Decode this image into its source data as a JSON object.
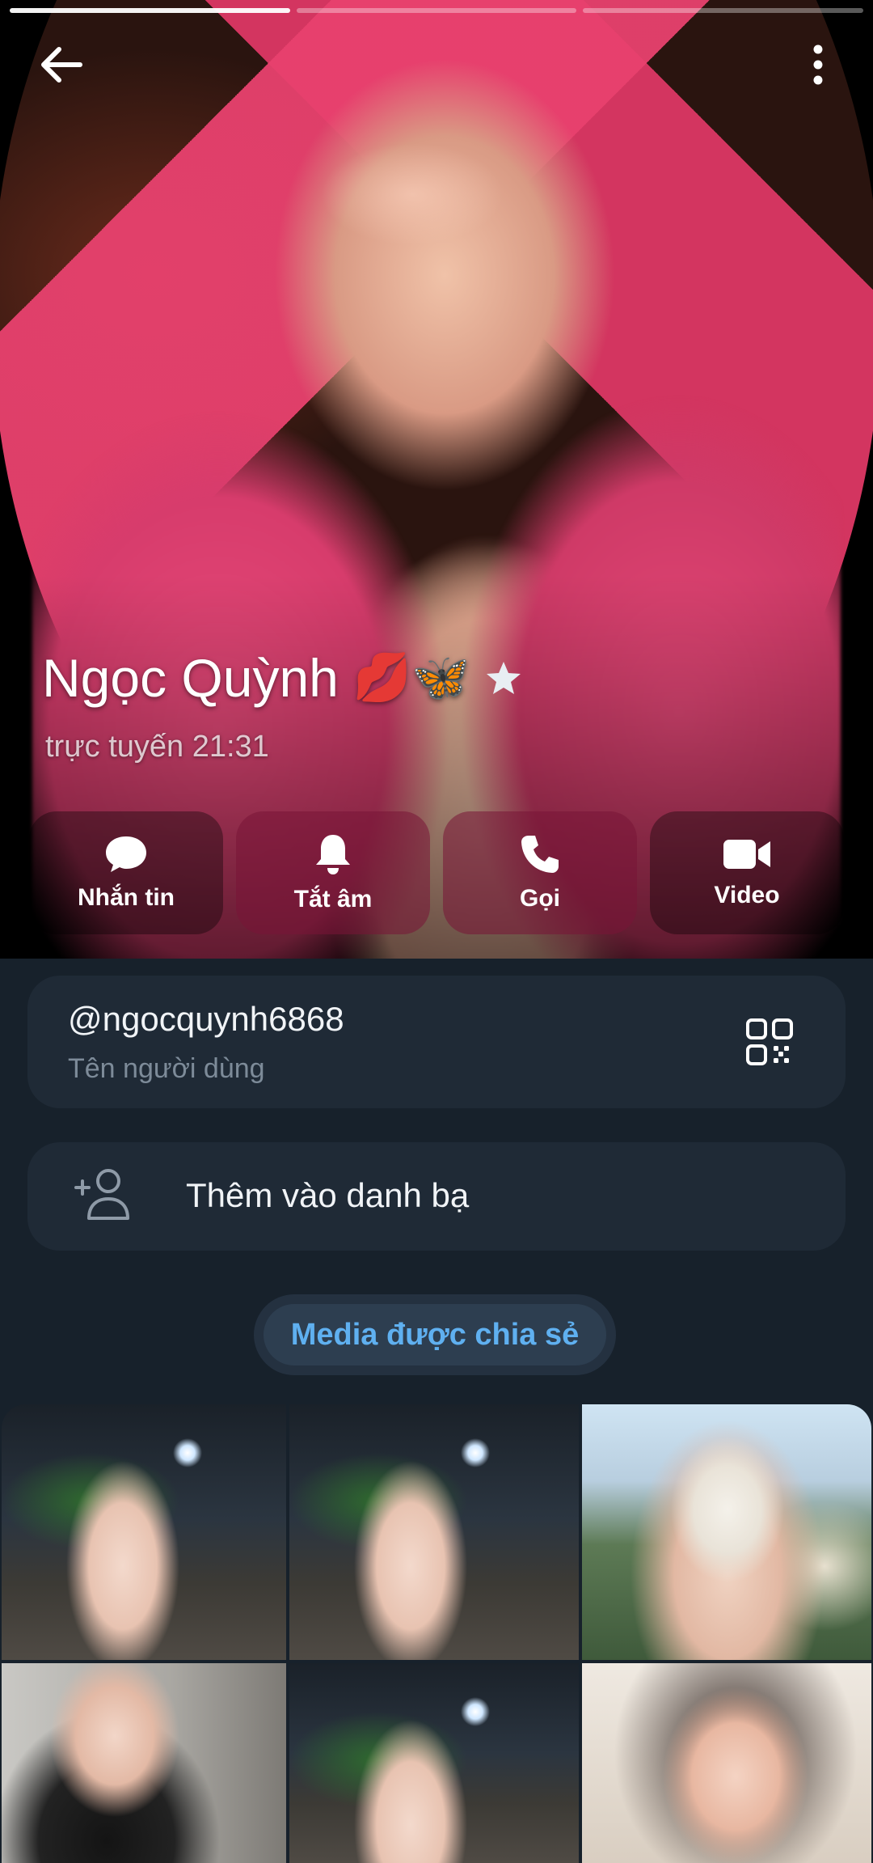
{
  "profile": {
    "name": "Ngọc Quỳnh",
    "name_emoji": "💋🦋",
    "status": "trực tuyến 21:31"
  },
  "story_bars": {
    "count": 3,
    "active_index": 0
  },
  "actions": [
    {
      "label": "Nhắn tin",
      "icon": "chat-bubble-icon"
    },
    {
      "label": "Tắt âm",
      "icon": "bell-icon"
    },
    {
      "label": "Gọi",
      "icon": "phone-icon"
    },
    {
      "label": "Video",
      "icon": "video-camera-icon"
    }
  ],
  "username_card": {
    "username": "@ngocquynh6868",
    "caption": "Tên người dùng",
    "icon": "qr-code-icon"
  },
  "contact_card": {
    "label": "Thêm vào danh bạ",
    "icon": "add-user-icon"
  },
  "media": {
    "pill_label": "Media được chia sẻ"
  },
  "colors": {
    "background": "#17212b",
    "card": "#1f2a36",
    "accent": "#5fb0f0"
  }
}
